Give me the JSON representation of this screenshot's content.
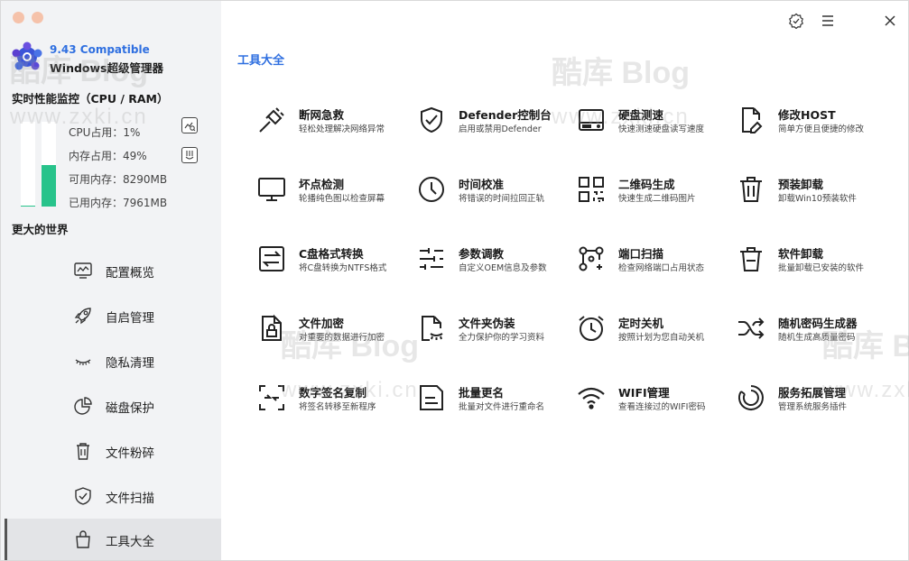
{
  "app": {
    "version": "9.43 Compatible",
    "name": "Windows超级管理器"
  },
  "perf": {
    "title": "实时性能监控（CPU / RAM）",
    "cpu_percent": 1,
    "mem_percent": 49,
    "cpu_label": "CPU占用：1%",
    "mem_label": "内存占用：49%",
    "avail_label": "可用内存：8290MB",
    "used_label": "已用内存：7961MB"
  },
  "world_label": "更大的世界",
  "nav": [
    {
      "label": "配置概览",
      "icon": "monitor-chart-icon"
    },
    {
      "label": "自启管理",
      "icon": "rocket-icon"
    },
    {
      "label": "隐私清理",
      "icon": "eye-closed-icon"
    },
    {
      "label": "磁盘保护",
      "icon": "pie-chart-icon"
    },
    {
      "label": "文件粉碎",
      "icon": "trash-icon"
    },
    {
      "label": "文件扫描",
      "icon": "shield-check-icon"
    },
    {
      "label": "工具大全",
      "icon": "bag-icon",
      "active": true
    }
  ],
  "main": {
    "title": "工具大全"
  },
  "tools": [
    {
      "name": "断网急救",
      "desc": "轻松处理解决网络异常",
      "icon": "plug-icon"
    },
    {
      "name": "Defender控制台",
      "desc": "启用或禁用Defender",
      "icon": "shield-check-icon"
    },
    {
      "name": "硬盘测速",
      "desc": "快速测速硬盘读写速度",
      "icon": "hard-drive-icon"
    },
    {
      "name": "修改HOST",
      "desc": "简单方便且便捷的修改",
      "icon": "file-edit-icon"
    },
    {
      "name": "坏点检测",
      "desc": "轮播纯色图以检查屏幕",
      "icon": "monitor-icon"
    },
    {
      "name": "时间校准",
      "desc": "将错误的时间拉回正轨",
      "icon": "clock-icon"
    },
    {
      "name": "二维码生成",
      "desc": "快速生成二维码图片",
      "icon": "qr-code-icon"
    },
    {
      "name": "预装卸载",
      "desc": "卸载Win10预装软件",
      "icon": "trash-icon"
    },
    {
      "name": "C盘格式转换",
      "desc": "将C盘转换为NTFS格式",
      "icon": "swap-icon"
    },
    {
      "name": "参数调教",
      "desc": "自定义OEM信息及参数",
      "icon": "sliders-icon"
    },
    {
      "name": "端口扫描",
      "desc": "检查网络端口占用状态",
      "icon": "port-scan-icon"
    },
    {
      "name": "软件卸载",
      "desc": "批量卸载已安装的软件",
      "icon": "trash-can-icon"
    },
    {
      "name": "文件加密",
      "desc": "对重要的数据进行加密",
      "icon": "file-lock-icon"
    },
    {
      "name": "文件夹伪装",
      "desc": "全力保护你的学习资料",
      "icon": "file-mask-icon"
    },
    {
      "name": "定时关机",
      "desc": "按照计划为您自动关机",
      "icon": "alarm-clock-icon"
    },
    {
      "name": "随机密码生成器",
      "desc": "随机生成高质量密码",
      "icon": "shuffle-icon"
    },
    {
      "name": "数字签名复制",
      "desc": "将签名转移至新程序",
      "icon": "signature-copy-icon"
    },
    {
      "name": "批量更名",
      "desc": "批量对文件进行重命名",
      "icon": "rename-icon"
    },
    {
      "name": "WIFI管理",
      "desc": "查看连接过的WIFI密码",
      "icon": "wifi-icon"
    },
    {
      "name": "服务拓展管理",
      "desc": "管理系统服务插件",
      "icon": "service-ring-icon"
    }
  ],
  "watermark": {
    "brand": "酷库 Blog",
    "url": "www.zxki.cn"
  }
}
